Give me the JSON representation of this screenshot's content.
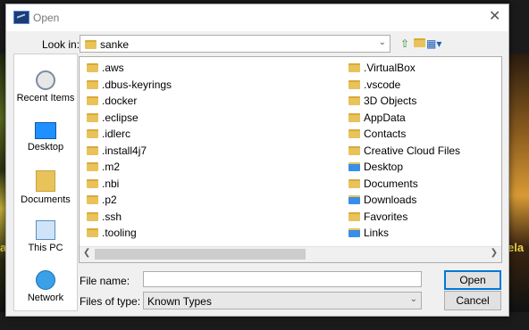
{
  "dialog": {
    "title": "Open",
    "close_symbol": "✕"
  },
  "lookin": {
    "label": "Look in:",
    "value": "sanke"
  },
  "places": [
    {
      "name": "recent-items",
      "label": "Recent Items",
      "icon": "recent-items-icon"
    },
    {
      "name": "desktop",
      "label": "Desktop",
      "icon": "desktop-icon"
    },
    {
      "name": "documents",
      "label": "Documents",
      "icon": "documents-icon"
    },
    {
      "name": "this-pc",
      "label": "This PC",
      "icon": "this-pc-icon"
    },
    {
      "name": "network",
      "label": "Network",
      "icon": "network-icon"
    }
  ],
  "files": {
    "col1": [
      ".aws",
      ".dbus-keyrings",
      ".docker",
      ".eclipse",
      ".idlerc",
      ".install4j7",
      ".m2",
      ".nbi",
      ".p2",
      ".ssh",
      ".tooling"
    ],
    "col2": [
      ".VirtualBox",
      ".vscode",
      "3D Objects",
      "AppData",
      "Contacts",
      "Creative Cloud Files",
      "Desktop",
      "Documents",
      "Downloads",
      "Favorites",
      "Links"
    ]
  },
  "filename": {
    "label": "File name:",
    "value": ""
  },
  "filetype": {
    "label": "Files of type:",
    "value": "Known Types"
  },
  "buttons": {
    "open": "Open",
    "cancel": "Cancel"
  },
  "background": {
    "left_text": "a",
    "right_text": "ela"
  }
}
